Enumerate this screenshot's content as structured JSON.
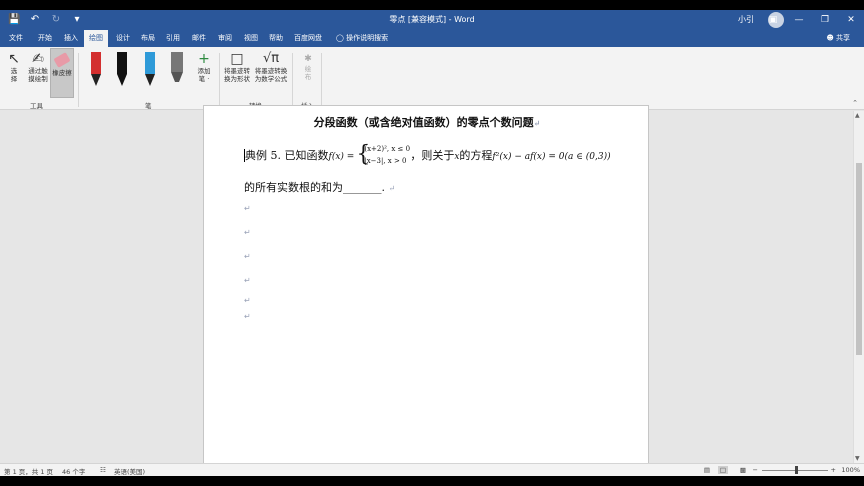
{
  "titlebar": {
    "document_title": "零点 [兼容模式] - Word",
    "user_name": "小引",
    "qat": {
      "save_icon": "save-icon",
      "undo_icon": "undo-icon",
      "redo_icon": "redo-icon",
      "customize_icon": "dropdown-icon"
    }
  },
  "tabs": [
    {
      "label": "文件"
    },
    {
      "label": "开始"
    },
    {
      "label": "插入"
    },
    {
      "label": "绘图"
    },
    {
      "label": "设计"
    },
    {
      "label": "布局"
    },
    {
      "label": "引用"
    },
    {
      "label": "邮件"
    },
    {
      "label": "审阅"
    },
    {
      "label": "视图"
    },
    {
      "label": "帮助"
    },
    {
      "label": "百度网盘"
    }
  ],
  "tell_me": "操作说明搜索",
  "share": "共享",
  "ribbon": {
    "tools": {
      "select_label": "选\n择",
      "touch_draw_label": "通过触\n摸绘制",
      "eraser_label": "橡皮擦",
      "group_label": "工具"
    },
    "pens": {
      "colors": [
        "#d32f2f",
        "#111111",
        "#2e9ad8",
        "#777777"
      ],
      "add_pen_label": "添加\n笔 ·",
      "group_label": "笔"
    },
    "convert": {
      "ink_to_shape_label": "将墨迹转\n换为形状",
      "ink_to_math_label": "将墨迹转换\n为数学公式",
      "group_label": "转换"
    },
    "insert": {
      "drawing_label": "绘\n布",
      "group_label": "插入"
    }
  },
  "document": {
    "heading": "分段函数（或含绝对值函数）的零点个数问题",
    "para1_prefix": "典例 5. 已知函数",
    "func_lhs": "f(x) =",
    "piece1": "(x+2)², x ≤ 0",
    "piece2": "|x−3|, x > 0",
    "para1_suffix": "，则关于",
    "var_x": "x",
    "para1_equation_prefix": "的方程",
    "equation": "f²(x) − af(x) = 0(a ∈ (0,3))",
    "para2": "的所有实数根的和为_______.",
    "paragraph_mark": "↵"
  },
  "status": {
    "page": "第 1 页，共 1 页",
    "words": "46 个字",
    "language": "英语(美国)",
    "zoom": "100%"
  }
}
